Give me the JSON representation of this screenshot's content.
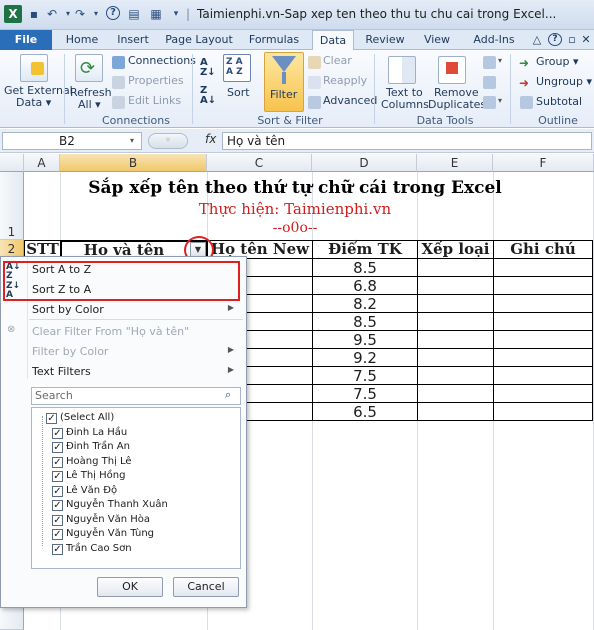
{
  "window": {
    "title": "Taimienphi.vn-Sap xep ten theo thu tu chu cai trong Excel..."
  },
  "tabs": [
    "File",
    "Home",
    "Insert",
    "Page Layout",
    "Formulas",
    "Data",
    "Review",
    "View",
    "Add-Ins"
  ],
  "ribbon": {
    "get_external_data": "Get External",
    "get_external_data2": "Data ▾",
    "refresh": "Refresh",
    "refresh2": "All ▾",
    "connections": "Connections",
    "properties": "Properties",
    "edit_links": "Edit Links",
    "group_connections": "Connections",
    "sort": "Sort",
    "filter": "Filter",
    "clear": "Clear",
    "reapply": "Reapply",
    "advanced": "Advanced",
    "group_sort_filter": "Sort & Filter",
    "text_to_columns": "Text to",
    "text_to_columns2": "Columns",
    "remove_duplicates": "Remove",
    "remove_duplicates2": "Duplicates",
    "group_data_tools": "Data Tools",
    "group": "Group ▾",
    "ungroup": "Ungroup ▾",
    "subtotal": "Subtotal",
    "group_outline": "Outline"
  },
  "formula_bar": {
    "name_box": "B2",
    "fx": "fx",
    "content": "Họ và tên"
  },
  "columns": [
    "A",
    "B",
    "C",
    "D",
    "E",
    "F"
  ],
  "rows": [
    "1",
    "2"
  ],
  "sheet": {
    "title": "Sắp xếp tên theo thứ tự chữ cái trong Excel",
    "subtitle": "Thực hiện: Taimienphi.vn",
    "ornament": "--o0o--",
    "headers": [
      "STT",
      "Họ và tên",
      "Họ tên New",
      "Điểm TK",
      "Xếp loại",
      "Ghi chú"
    ],
    "scores": [
      "8.5",
      "6.8",
      "8.2",
      "8.5",
      "9.5",
      "9.2",
      "7.5",
      "7.5",
      "6.5"
    ]
  },
  "dropdown": {
    "sort_az": "Sort A to Z",
    "sort_za": "Sort Z to A",
    "sort_by_color": "Sort by Color",
    "clear_filter": "Clear Filter From \"Họ và tên\"",
    "filter_by_color": "Filter by Color",
    "text_filters": "Text Filters",
    "search_placeholder": "Search",
    "items": [
      "(Select All)",
      "Đinh La Hầu",
      "Đinh Trần An",
      "Hoàng Thị Lê",
      "Lê Thị Hồng",
      "Lê Văn Độ",
      "Nguyễn Thanh Xuân",
      "Nguyễn Văn Hòa",
      "Nguyễn Văn Tùng",
      "Trần Cao Sơn"
    ],
    "ok": "OK",
    "cancel": "Cancel"
  },
  "colors": {
    "accent_red": "#e02020",
    "file_tab": "#2a6db8",
    "excel_green": "#1f7244"
  }
}
